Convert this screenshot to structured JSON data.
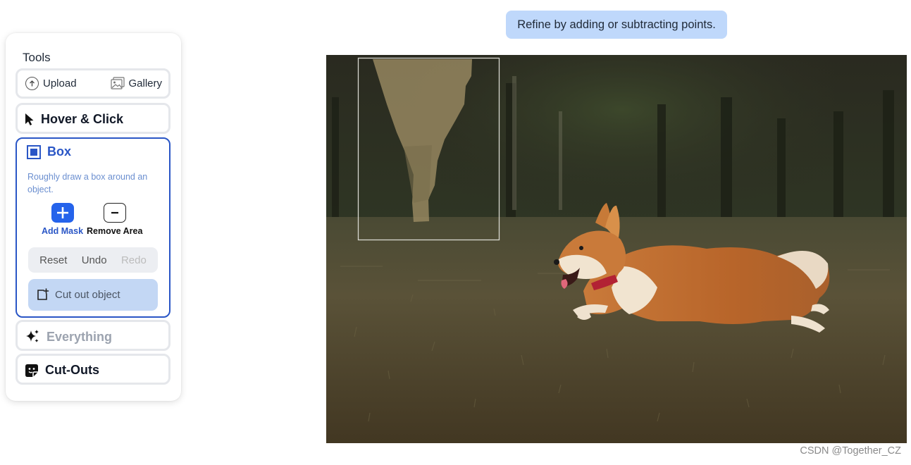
{
  "tools": {
    "title": "Tools",
    "upload_label": "Upload",
    "gallery_label": "Gallery",
    "hover_click_label": "Hover & Click",
    "box": {
      "label": "Box",
      "description": "Roughly draw a box around an object.",
      "add_mask_label": "Add Mask",
      "remove_area_label": "Remove Area",
      "reset_label": "Reset",
      "undo_label": "Undo",
      "redo_label": "Redo",
      "cut_out_label": "Cut out object"
    },
    "everything_label": "Everything",
    "cutouts_label": "Cut-Outs"
  },
  "hint": {
    "text": "Refine by adding or subtracting points."
  },
  "watermark": "CSDN @Together_CZ",
  "colors": {
    "accent": "#2563eb",
    "active_border": "#2a56c6",
    "hint_bg": "#bfd8fb",
    "cutout_bg": "#c3d7f4"
  }
}
